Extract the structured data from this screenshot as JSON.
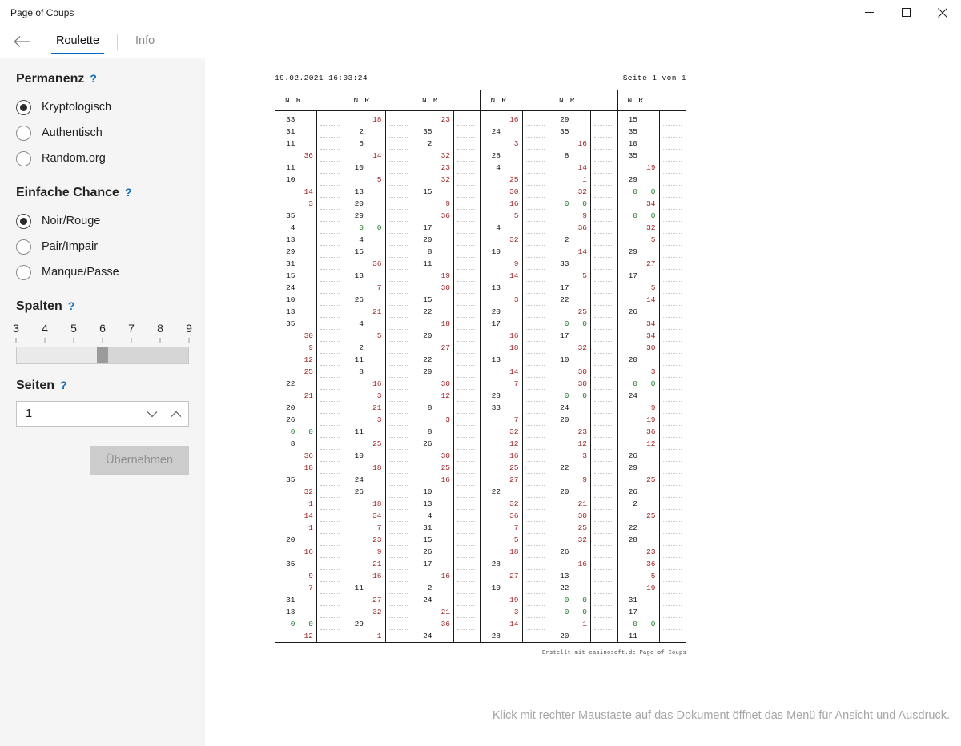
{
  "window": {
    "title": "Page of Coups",
    "controls": {
      "minimize": "minimize-icon",
      "maximize": "maximize-icon",
      "close": "close-icon"
    }
  },
  "tabs": {
    "back": "back-arrow-icon",
    "items": [
      {
        "label": "Roulette",
        "active": true
      },
      {
        "label": "Info",
        "active": false
      }
    ]
  },
  "sidebar": {
    "permanenz": {
      "title": "Permanenz",
      "help": "?",
      "options": [
        {
          "label": "Kryptologisch",
          "checked": true
        },
        {
          "label": "Authentisch",
          "checked": false
        },
        {
          "label": "Random.org",
          "checked": false
        }
      ]
    },
    "einfache_chance": {
      "title": "Einfache Chance",
      "help": "?",
      "options": [
        {
          "label": "Noir/Rouge",
          "checked": true
        },
        {
          "label": "Pair/Impair",
          "checked": false
        },
        {
          "label": "Manque/Passe",
          "checked": false
        }
      ]
    },
    "spalten": {
      "title": "Spalten",
      "help": "?",
      "ticks": [
        "3",
        "4",
        "5",
        "6",
        "7",
        "8",
        "9"
      ],
      "value": 6,
      "min": 3,
      "max": 9
    },
    "seiten": {
      "title": "Seiten",
      "help": "?",
      "value": "1",
      "down_icon": "chevron-down-icon",
      "up_icon": "chevron-up-icon"
    },
    "apply_label": "Übernehmen"
  },
  "document": {
    "timestamp": "19.02.2021 16:03:24",
    "page_info": "Seite 1 von 1",
    "column_header": "N R",
    "footer": "Erstellt mit casinosoft.de Page of Coups",
    "colors": {
      "noir": "#111111",
      "rouge": "#9e1a1a",
      "zero": "#1f7a2e"
    },
    "columns": [
      {
        "rows": [
          {
            "n": "33"
          },
          {
            "n": "31"
          },
          {
            "n": "11"
          },
          {
            "r": "36"
          },
          {
            "n": "11"
          },
          {
            "n": "10"
          },
          {
            "r": "14"
          },
          {
            "r": "3"
          },
          {
            "n": "35"
          },
          {
            "n": "4"
          },
          {
            "n": "13"
          },
          {
            "n": "29"
          },
          {
            "n": "31"
          },
          {
            "n": "15"
          },
          {
            "n": "24"
          },
          {
            "n": "10"
          },
          {
            "n": "13"
          },
          {
            "n": "35"
          },
          {
            "r": "30"
          },
          {
            "r": "9"
          },
          {
            "r": "12"
          },
          {
            "r": "25"
          },
          {
            "n": "22"
          },
          {
            "r": "21"
          },
          {
            "n": "20"
          },
          {
            "n": "26"
          },
          {
            "n": "0",
            "r": "0",
            "zero": true
          },
          {
            "n": "8"
          },
          {
            "r": "36"
          },
          {
            "r": "18"
          },
          {
            "n": "35"
          },
          {
            "r": "32"
          },
          {
            "r": "1"
          },
          {
            "r": "14"
          },
          {
            "r": "1"
          },
          {
            "n": "20"
          },
          {
            "r": "16"
          },
          {
            "n": "35"
          },
          {
            "r": "9"
          },
          {
            "r": "7"
          },
          {
            "n": "31"
          },
          {
            "n": "13"
          },
          {
            "n": "0",
            "r": "0",
            "zero": true
          },
          {
            "r": "12"
          }
        ]
      },
      {
        "rows": [
          {
            "r": "18"
          },
          {
            "n": "2"
          },
          {
            "n": "6"
          },
          {
            "r": "14"
          },
          {
            "n": "10"
          },
          {
            "r": "5"
          },
          {
            "n": "13"
          },
          {
            "n": "20"
          },
          {
            "n": "29"
          },
          {
            "n": "0",
            "r": "0",
            "zero": true
          },
          {
            "n": "4"
          },
          {
            "n": "15"
          },
          {
            "r": "36"
          },
          {
            "n": "13"
          },
          {
            "r": "7"
          },
          {
            "n": "26"
          },
          {
            "r": "21"
          },
          {
            "n": "4"
          },
          {
            "r": "5"
          },
          {
            "n": "2"
          },
          {
            "n": "11"
          },
          {
            "n": "8"
          },
          {
            "r": "16"
          },
          {
            "r": "3"
          },
          {
            "r": "21"
          },
          {
            "r": "3"
          },
          {
            "n": "11"
          },
          {
            "r": "25"
          },
          {
            "n": "10"
          },
          {
            "r": "18"
          },
          {
            "n": "24"
          },
          {
            "n": "26"
          },
          {
            "r": "18"
          },
          {
            "r": "34"
          },
          {
            "r": "7"
          },
          {
            "r": "23"
          },
          {
            "r": "9"
          },
          {
            "r": "21"
          },
          {
            "r": "16"
          },
          {
            "n": "11"
          },
          {
            "r": "27"
          },
          {
            "r": "32"
          },
          {
            "n": "29"
          },
          {
            "r": "1"
          }
        ]
      },
      {
        "rows": [
          {
            "r": "23"
          },
          {
            "n": "35"
          },
          {
            "n": "2"
          },
          {
            "r": "32"
          },
          {
            "r": "23"
          },
          {
            "r": "32"
          },
          {
            "n": "15"
          },
          {
            "r": "9"
          },
          {
            "r": "36"
          },
          {
            "n": "17"
          },
          {
            "n": "20"
          },
          {
            "n": "8"
          },
          {
            "n": "11"
          },
          {
            "r": "19"
          },
          {
            "r": "30"
          },
          {
            "n": "15"
          },
          {
            "n": "22"
          },
          {
            "r": "18"
          },
          {
            "n": "20"
          },
          {
            "r": "27"
          },
          {
            "n": "22"
          },
          {
            "n": "29"
          },
          {
            "r": "30"
          },
          {
            "r": "12"
          },
          {
            "n": "8"
          },
          {
            "r": "3"
          },
          {
            "n": "8"
          },
          {
            "n": "26"
          },
          {
            "r": "30"
          },
          {
            "r": "25"
          },
          {
            "r": "16"
          },
          {
            "n": "10"
          },
          {
            "n": "13"
          },
          {
            "n": "4"
          },
          {
            "n": "31"
          },
          {
            "n": "15"
          },
          {
            "n": "26"
          },
          {
            "n": "17"
          },
          {
            "r": "16"
          },
          {
            "n": "2"
          },
          {
            "n": "24"
          },
          {
            "r": "21"
          },
          {
            "r": "36"
          },
          {
            "n": "24"
          }
        ]
      },
      {
        "rows": [
          {
            "r": "16"
          },
          {
            "n": "24"
          },
          {
            "r": "3"
          },
          {
            "n": "28"
          },
          {
            "n": "4"
          },
          {
            "r": "25"
          },
          {
            "r": "30"
          },
          {
            "r": "16"
          },
          {
            "r": "5"
          },
          {
            "n": "4"
          },
          {
            "r": "32"
          },
          {
            "n": "10"
          },
          {
            "r": "9"
          },
          {
            "r": "14"
          },
          {
            "n": "13"
          },
          {
            "r": "3"
          },
          {
            "n": "20"
          },
          {
            "n": "17"
          },
          {
            "r": "16"
          },
          {
            "r": "18"
          },
          {
            "n": "13"
          },
          {
            "r": "14"
          },
          {
            "r": "7"
          },
          {
            "n": "28"
          },
          {
            "n": "33"
          },
          {
            "r": "7"
          },
          {
            "r": "32"
          },
          {
            "r": "12"
          },
          {
            "r": "16"
          },
          {
            "r": "25"
          },
          {
            "r": "27"
          },
          {
            "n": "22"
          },
          {
            "r": "32"
          },
          {
            "r": "36"
          },
          {
            "r": "7"
          },
          {
            "r": "5"
          },
          {
            "r": "18"
          },
          {
            "n": "28"
          },
          {
            "r": "27"
          },
          {
            "n": "10"
          },
          {
            "r": "19"
          },
          {
            "r": "3"
          },
          {
            "r": "14"
          },
          {
            "n": "28"
          }
        ]
      },
      {
        "rows": [
          {
            "n": "29"
          },
          {
            "n": "35"
          },
          {
            "r": "16"
          },
          {
            "n": "8"
          },
          {
            "r": "14"
          },
          {
            "r": "1"
          },
          {
            "r": "32"
          },
          {
            "n": "0",
            "r": "0",
            "zero": true
          },
          {
            "r": "9"
          },
          {
            "r": "36"
          },
          {
            "n": "2"
          },
          {
            "r": "14"
          },
          {
            "n": "33"
          },
          {
            "r": "5"
          },
          {
            "n": "17"
          },
          {
            "n": "22"
          },
          {
            "r": "25"
          },
          {
            "n": "0",
            "r": "0",
            "zero": true
          },
          {
            "n": "17"
          },
          {
            "r": "32"
          },
          {
            "n": "10"
          },
          {
            "r": "30"
          },
          {
            "r": "30"
          },
          {
            "n": "0",
            "r": "0",
            "zero": true
          },
          {
            "n": "24"
          },
          {
            "n": "20"
          },
          {
            "r": "23"
          },
          {
            "r": "12"
          },
          {
            "r": "3"
          },
          {
            "n": "22"
          },
          {
            "r": "9"
          },
          {
            "n": "20"
          },
          {
            "r": "21"
          },
          {
            "r": "30"
          },
          {
            "r": "25"
          },
          {
            "r": "32"
          },
          {
            "n": "26"
          },
          {
            "r": "16"
          },
          {
            "n": "13"
          },
          {
            "n": "22"
          },
          {
            "n": "0",
            "r": "0",
            "zero": true
          },
          {
            "n": "0",
            "r": "0",
            "zero": true
          },
          {
            "r": "1"
          },
          {
            "n": "20"
          }
        ]
      },
      {
        "rows": [
          {
            "n": "15"
          },
          {
            "n": "35"
          },
          {
            "n": "10"
          },
          {
            "n": "35"
          },
          {
            "r": "19"
          },
          {
            "n": "29"
          },
          {
            "n": "0",
            "r": "0",
            "zero": true
          },
          {
            "r": "34"
          },
          {
            "n": "0",
            "r": "0",
            "zero": true
          },
          {
            "r": "32"
          },
          {
            "r": "5"
          },
          {
            "n": "29"
          },
          {
            "r": "27"
          },
          {
            "n": "17"
          },
          {
            "r": "5"
          },
          {
            "r": "14"
          },
          {
            "n": "26"
          },
          {
            "r": "34"
          },
          {
            "r": "34"
          },
          {
            "r": "30"
          },
          {
            "n": "20"
          },
          {
            "r": "3"
          },
          {
            "n": "0",
            "r": "0",
            "zero": true
          },
          {
            "n": "24"
          },
          {
            "r": "9"
          },
          {
            "r": "19"
          },
          {
            "r": "36"
          },
          {
            "r": "12"
          },
          {
            "n": "26"
          },
          {
            "n": "29"
          },
          {
            "r": "25"
          },
          {
            "n": "26"
          },
          {
            "n": "2"
          },
          {
            "r": "25"
          },
          {
            "n": "22"
          },
          {
            "n": "28"
          },
          {
            "r": "23"
          },
          {
            "r": "36"
          },
          {
            "r": "5"
          },
          {
            "r": "19"
          },
          {
            "n": "31"
          },
          {
            "n": "17"
          },
          {
            "n": "0",
            "r": "0",
            "zero": true
          },
          {
            "n": "11"
          }
        ]
      }
    ]
  },
  "statusbar": {
    "hint": "Klick mit rechter Maustaste auf das Dokument öffnet das Menü für Ansicht und Ausdruck."
  }
}
